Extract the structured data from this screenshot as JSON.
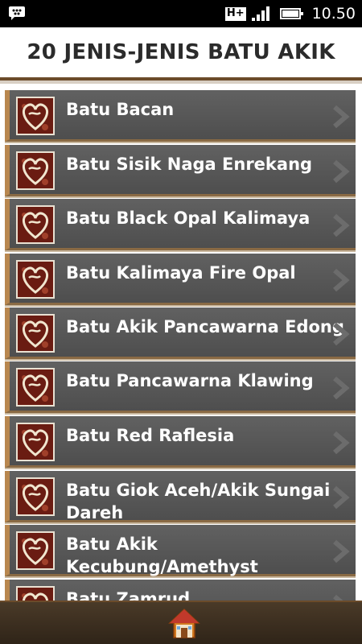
{
  "status_bar": {
    "network_type": "H+",
    "time": "10.50",
    "icons": [
      "bbm-icon",
      "signal-icon",
      "battery-icon"
    ]
  },
  "header": {
    "title": "20 JENIS-JENIS BATU AKIK"
  },
  "list": {
    "items": [
      {
        "label": "Batu Bacan"
      },
      {
        "label": "Batu Sisik Naga Enrekang"
      },
      {
        "label": "Batu Black Opal Kalimaya"
      },
      {
        "label": "Batu Kalimaya Fire Opal"
      },
      {
        "label": "Batu Akik Pancawarna Edong"
      },
      {
        "label": "Batu Pancawarna Klawing"
      },
      {
        "label": "Batu Red Raflesia"
      },
      {
        "label": "Batu Giok Aceh/Akik Sungai Dareh"
      },
      {
        "label": "Batu Akik Kecubung/Amethyst"
      },
      {
        "label": "Batu Zamrud"
      }
    ]
  },
  "bottom_bar": {
    "home_icon": "home-icon"
  },
  "colors": {
    "item_bg": "#575757",
    "accent_brown": "#6b4b2a",
    "item_text": "#ffffff"
  }
}
